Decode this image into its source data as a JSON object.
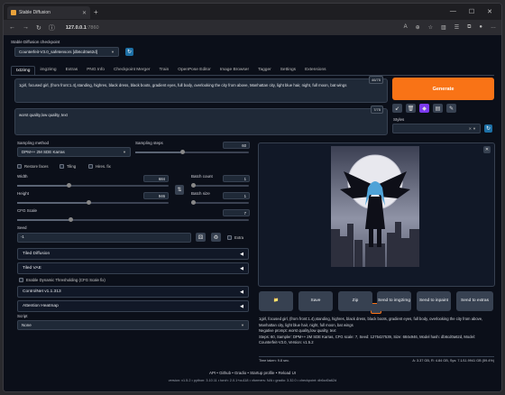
{
  "browser": {
    "tab_title": "Stable Diffusion",
    "url_host": "127.0.0.1",
    "url_port": ":7860"
  },
  "checkpoint": {
    "label": "Stable Diffusion checkpoint",
    "value": "Counterfeit-V3.0_safetensors [db6cd0a62d]"
  },
  "tabs": [
    "txt2img",
    "img2img",
    "Extras",
    "PNG Info",
    "Checkpoint Merger",
    "Train",
    "OpenPose Editor",
    "Image Browser",
    "Tagger",
    "Settings",
    "Extensions"
  ],
  "prompt": {
    "text": "1girl, focused girl, (from front:1.4),standing, highres, black dress, black boots, gradient eyes, full body, overlooking the city from above, Manhattan city, light blue hair, night, full moon, bat wings",
    "counter": "46/75"
  },
  "negative": {
    "text": "worst quality,low quality, text",
    "counter": "7/75"
  },
  "generate_label": "Generate",
  "styles_label": "Styles",
  "sampling": {
    "method_label": "Sampling method",
    "method_value": "DPM++ 2M SDE Karras",
    "steps_label": "Sampling steps",
    "steps_value": "60"
  },
  "checks": {
    "restore_faces": "Restore faces",
    "tiling": "Tiling",
    "hires_fix": "Hires. fix"
  },
  "width": {
    "label": "Width",
    "value": "684"
  },
  "height": {
    "label": "Height",
    "value": "946"
  },
  "batch_count": {
    "label": "Batch count",
    "value": "1"
  },
  "batch_size": {
    "label": "Batch size",
    "value": "1"
  },
  "cfg": {
    "label": "CFG Scale",
    "value": "7"
  },
  "seed": {
    "label": "Seed",
    "value": "-1",
    "extra": "Extra"
  },
  "accordions": {
    "tiled_diffusion": "Tiled Diffusion",
    "tiled_vae": "Tiled VAE",
    "dynamic": "Enable Dynamic Thresholding (CFG Scale fix)",
    "controlnet": "ControlNet v1.1.313",
    "attention": "Attention Heatmap"
  },
  "script": {
    "label": "Script",
    "value": "None"
  },
  "actions": {
    "folder": "📁",
    "save": "Save",
    "zip": "Zip",
    "to_img2img": "Send to img2img",
    "to_inpaint": "Send to inpaint",
    "to_extras": "Send to extras"
  },
  "info": {
    "line1": "1girl, focused girl, (from front:1.4),standing, highres, black dress, black boots, gradient eyes, full body, overlooking the city from above, Manhattan city, light blue hair, night, full moon, bat wings",
    "line2": "Negative prompt: worst quality,low quality, text",
    "line3": "Steps: 60, Sampler: DPM++ 2M SDE Karras, CFG scale: 7, Seed: 1275427539, Size: 684x946, Model hash: db6cd0a62d, Model: Counterfeit-V3.0, Version: v1.5.2",
    "time": "Time taken: 9.8 sec.",
    "vram": "A: 3.37 GB, R: 4.84 GB, Sys: 7.1/11.9941 GB (59.4%)"
  },
  "footer": {
    "links": "API  •  Github  •  Gradio  •  Startup profile  •  Reload UI",
    "versions": "version: v1.5.2  •  python: 3.10.11  •  torch: 2.0.1+cu118  •  xformers: N/A  •  gradio: 3.32.0  •  checkpoint: db6cd0a62d"
  }
}
